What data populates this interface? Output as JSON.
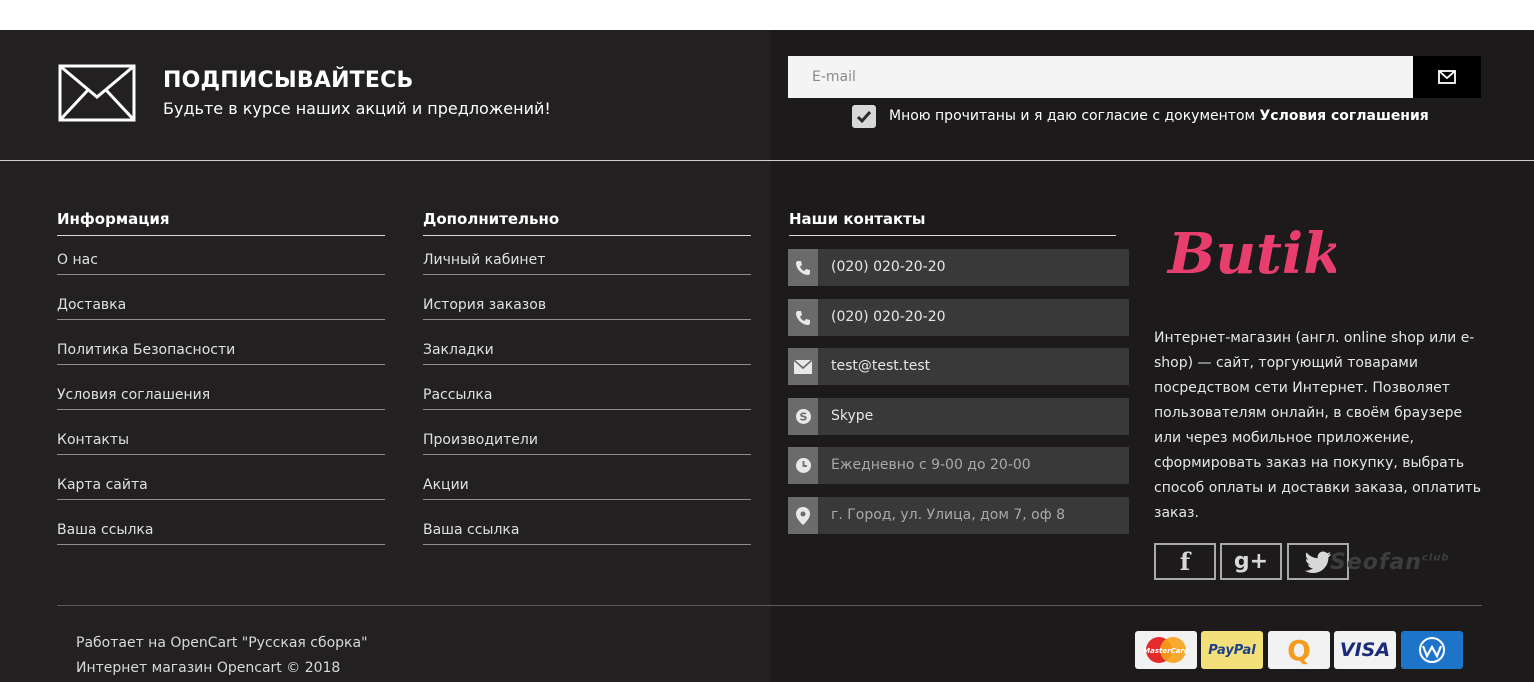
{
  "subscribe": {
    "title": "ПОДПИСЫВАЙТЕСЬ",
    "subtitle": "Будьте в курсе наших акций и предложений!",
    "email_placeholder": "E-mail",
    "agree_text": "Мною прочитаны и я даю согласие с документом ",
    "agree_link": "Условия соглашения",
    "agree_checked": true
  },
  "columns": {
    "info": {
      "title": "Информация",
      "links": [
        "О нас",
        "Доставка",
        "Политика Безопасности",
        "Условия соглашения",
        "Контакты",
        "Карта сайта",
        "Ваша ссылка"
      ]
    },
    "extra": {
      "title": "Дополнительно",
      "links": [
        "Личный кабинет",
        "История заказов",
        "Закладки",
        "Рассылка",
        "Производители",
        "Акции",
        "Ваша ссылка"
      ]
    }
  },
  "contacts": {
    "title": "Наши контакты",
    "items": [
      {
        "icon": "phone-icon",
        "text": "(020) 020-20-20"
      },
      {
        "icon": "phone-icon",
        "text": "(020) 020-20-20"
      },
      {
        "icon": "mail-icon",
        "text": "test@test.test"
      },
      {
        "icon": "skype-icon",
        "text": "Skype"
      },
      {
        "icon": "clock-icon",
        "text": "Ежедневно с 9-00 до 20-00"
      },
      {
        "icon": "map-pin-icon",
        "text": "г. Город, ул. Улица, дом 7, оф 8"
      }
    ]
  },
  "brand": {
    "logo_text": "Butik",
    "logo_color": "#e83e6e",
    "description": "Интернет-магазин (англ. online shop или e-shop) — сайт, торгующий товарами посредством сети Интернет. Позволяет пользователям онлайн, в своём браузере или через мобильное приложение, сформировать заказ на покупку, выбрать способ оплаты и доставки заказа, оплатить заказ."
  },
  "social": [
    {
      "icon": "facebook-icon",
      "label": "f"
    },
    {
      "icon": "google-plus-icon",
      "label": "g+"
    },
    {
      "icon": "twitter-icon",
      "label": ""
    }
  ],
  "watermark": {
    "text": "Seofan",
    "suffix": "club"
  },
  "bottom": {
    "powered_prefix": "Работает на ",
    "powered_link": "OpenCart \"Русская сборка\"",
    "copyright": "Интернет магазин Opencart © 2018"
  },
  "payments": [
    {
      "icon": "mastercard-icon",
      "label": "MasterCard"
    },
    {
      "icon": "paypal-icon",
      "label": "PayPal"
    },
    {
      "icon": "qiwi-icon",
      "label": "Q"
    },
    {
      "icon": "visa-icon",
      "label": "VISA"
    },
    {
      "icon": "webmoney-icon",
      "label": ""
    }
  ]
}
